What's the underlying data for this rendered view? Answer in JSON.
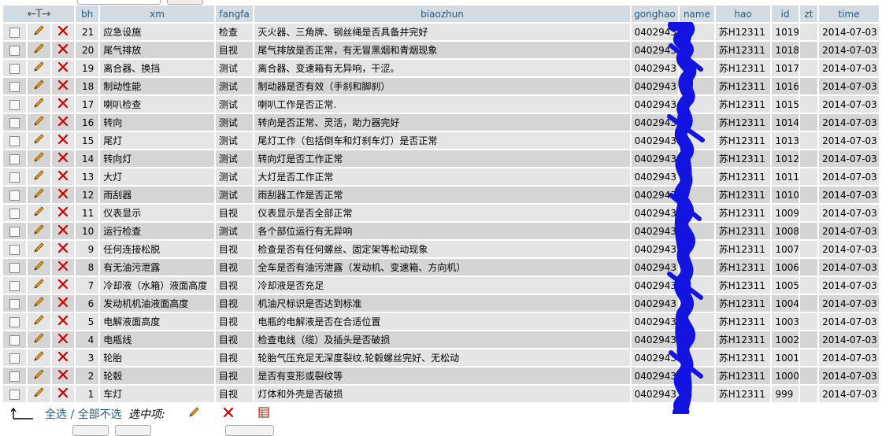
{
  "columns": {
    "arrows": "←T→",
    "bh": "bh",
    "xm": "xm",
    "fangfa": "fangfa",
    "biaozhun": "biaozhun",
    "gonghao": "gonghao",
    "name": "name",
    "hao": "hao",
    "id": "id",
    "zt": "zt",
    "time": "time"
  },
  "rows": [
    {
      "bh": "21",
      "xm": "应急设施",
      "fangfa": "检查",
      "biaozhun": "灭火器、三角牌、钢丝绳是否具备并完好",
      "gonghao": "0402943",
      "hao": "苏H12311",
      "id": "1019",
      "time": "2014-07-03"
    },
    {
      "bh": "20",
      "xm": "尾气排放",
      "fangfa": "目视",
      "biaozhun": "尾气排放是否正常，有无冒黑烟和青烟现象",
      "gonghao": "0402943",
      "hao": "苏H12311",
      "id": "1018",
      "time": "2014-07-03"
    },
    {
      "bh": "19",
      "xm": "离合器、换挡",
      "fangfa": "测试",
      "biaozhun": "离合器、变速箱有无异响，干涩。",
      "gonghao": "0402943",
      "hao": "苏H12311",
      "id": "1017",
      "time": "2014-07-03"
    },
    {
      "bh": "18",
      "xm": "制动性能",
      "fangfa": "测试",
      "biaozhun": "制动器是否有效（手刹和脚刹）",
      "gonghao": "0402943",
      "hao": "苏H12311",
      "id": "1016",
      "time": "2014-07-03"
    },
    {
      "bh": "17",
      "xm": "喇叭检查",
      "fangfa": "测试",
      "biaozhun": "喇叭工作是否正常.",
      "gonghao": "0402943",
      "hao": "苏H12311",
      "id": "1015",
      "time": "2014-07-03"
    },
    {
      "bh": "16",
      "xm": "转向",
      "fangfa": "测试",
      "biaozhun": "转向是否正常、灵活，助力器完好",
      "gonghao": "0402943",
      "hao": "苏H12311",
      "id": "1014",
      "time": "2014-07-03"
    },
    {
      "bh": "15",
      "xm": "尾灯",
      "fangfa": "测试",
      "biaozhun": "尾灯工作（包括倒车和灯刹车灯）是否正常",
      "gonghao": "0402943",
      "hao": "苏H12311",
      "id": "1013",
      "time": "2014-07-03"
    },
    {
      "bh": "14",
      "xm": "转向灯",
      "fangfa": "测试",
      "biaozhun": "转向灯是否工作正常",
      "gonghao": "0402943",
      "hao": "苏H12311",
      "id": "1012",
      "time": "2014-07-03"
    },
    {
      "bh": "13",
      "xm": "大灯",
      "fangfa": "测试",
      "biaozhun": "大灯是否工作正常",
      "gonghao": "0402943",
      "hao": "苏H12311",
      "id": "1011",
      "time": "2014-07-03"
    },
    {
      "bh": "12",
      "xm": "雨刮器",
      "fangfa": "测试",
      "biaozhun": "雨刮器工作是否正常",
      "gonghao": "0402943",
      "hao": "苏H12311",
      "id": "1010",
      "time": "2014-07-03"
    },
    {
      "bh": "11",
      "xm": "仪表显示",
      "fangfa": "目视",
      "biaozhun": "仪表显示是否全部正常",
      "gonghao": "0402943",
      "hao": "苏H12311",
      "id": "1009",
      "time": "2014-07-03"
    },
    {
      "bh": "10",
      "xm": "运行检查",
      "fangfa": "测试",
      "biaozhun": "各个部位运行有无异响",
      "gonghao": "0402943",
      "hao": "苏H12311",
      "id": "1008",
      "time": "2014-07-03"
    },
    {
      "bh": "9",
      "xm": "任何连接松脱",
      "fangfa": "目视",
      "biaozhun": "检查是否有任何螺丝、固定架等松动现象",
      "gonghao": "0402943",
      "hao": "苏H12311",
      "id": "1007",
      "time": "2014-07-03"
    },
    {
      "bh": "8",
      "xm": "有无油污泄露",
      "fangfa": "目视",
      "biaozhun": "全车是否有油污泄露（发动机、变速箱、方向机）",
      "gonghao": "0402943",
      "hao": "苏H12311",
      "id": "1006",
      "time": "2014-07-03"
    },
    {
      "bh": "7",
      "xm": "冷却液（水箱）液面高度",
      "fangfa": "目视",
      "biaozhun": "冷却液是否充足",
      "gonghao": "0402943",
      "hao": "苏H12311",
      "id": "1005",
      "time": "2014-07-03"
    },
    {
      "bh": "6",
      "xm": "发动机机油液面高度",
      "fangfa": "目视",
      "biaozhun": "机油尺标识是否达到标准",
      "gonghao": "0402943",
      "hao": "苏H12311",
      "id": "1004",
      "time": "2014-07-03"
    },
    {
      "bh": "5",
      "xm": "电解液面高度",
      "fangfa": "目视",
      "biaozhun": "电瓶的电解液是否在合适位置",
      "gonghao": "0402943",
      "hao": "苏H12311",
      "id": "1003",
      "time": "2014-07-03"
    },
    {
      "bh": "4",
      "xm": "电瓶线",
      "fangfa": "目视",
      "biaozhun": "检查电线（缆）及插头是否破损",
      "gonghao": "0402943",
      "hao": "苏H12311",
      "id": "1002",
      "time": "2014-07-03"
    },
    {
      "bh": "3",
      "xm": "轮胎",
      "fangfa": "目视",
      "biaozhun": "轮胎气压充足无深度裂纹.轮毂螺丝完好、无松动",
      "gonghao": "0402943",
      "hao": "苏H12311",
      "id": "1001",
      "time": "2014-07-03"
    },
    {
      "bh": "2",
      "xm": "轮毂",
      "fangfa": "目视",
      "biaozhun": "是否有变形或裂纹等",
      "gonghao": "0402943",
      "hao": "苏H12311",
      "id": "1000",
      "time": "2014-07-03"
    },
    {
      "bh": "1",
      "xm": "车灯",
      "fangfa": "目视",
      "biaozhun": "灯体和外壳是否破损",
      "gonghao": "0402943",
      "hao": "苏H12311",
      "id": "999",
      "time": "2014-07-03"
    }
  ],
  "footer": {
    "select_all": "全选",
    "separator": " / ",
    "deselect_all": "全部不选",
    "with_selected": "选中项:"
  },
  "colors": {
    "header_bg": "#d3dce3",
    "header_text": "#235a81",
    "row_odd": "#e5e5e5",
    "row_even": "#d5d5d5",
    "redaction": "#1414e0",
    "delete_red": "#cc0000"
  },
  "icons": {
    "row_checkbox": "checkbox-icon",
    "row_edit": "pencil-edit-icon",
    "row_delete": "red-x-delete-icon",
    "footer_corner": "corner-arrow-icon",
    "footer_export": "export-table-icon"
  }
}
